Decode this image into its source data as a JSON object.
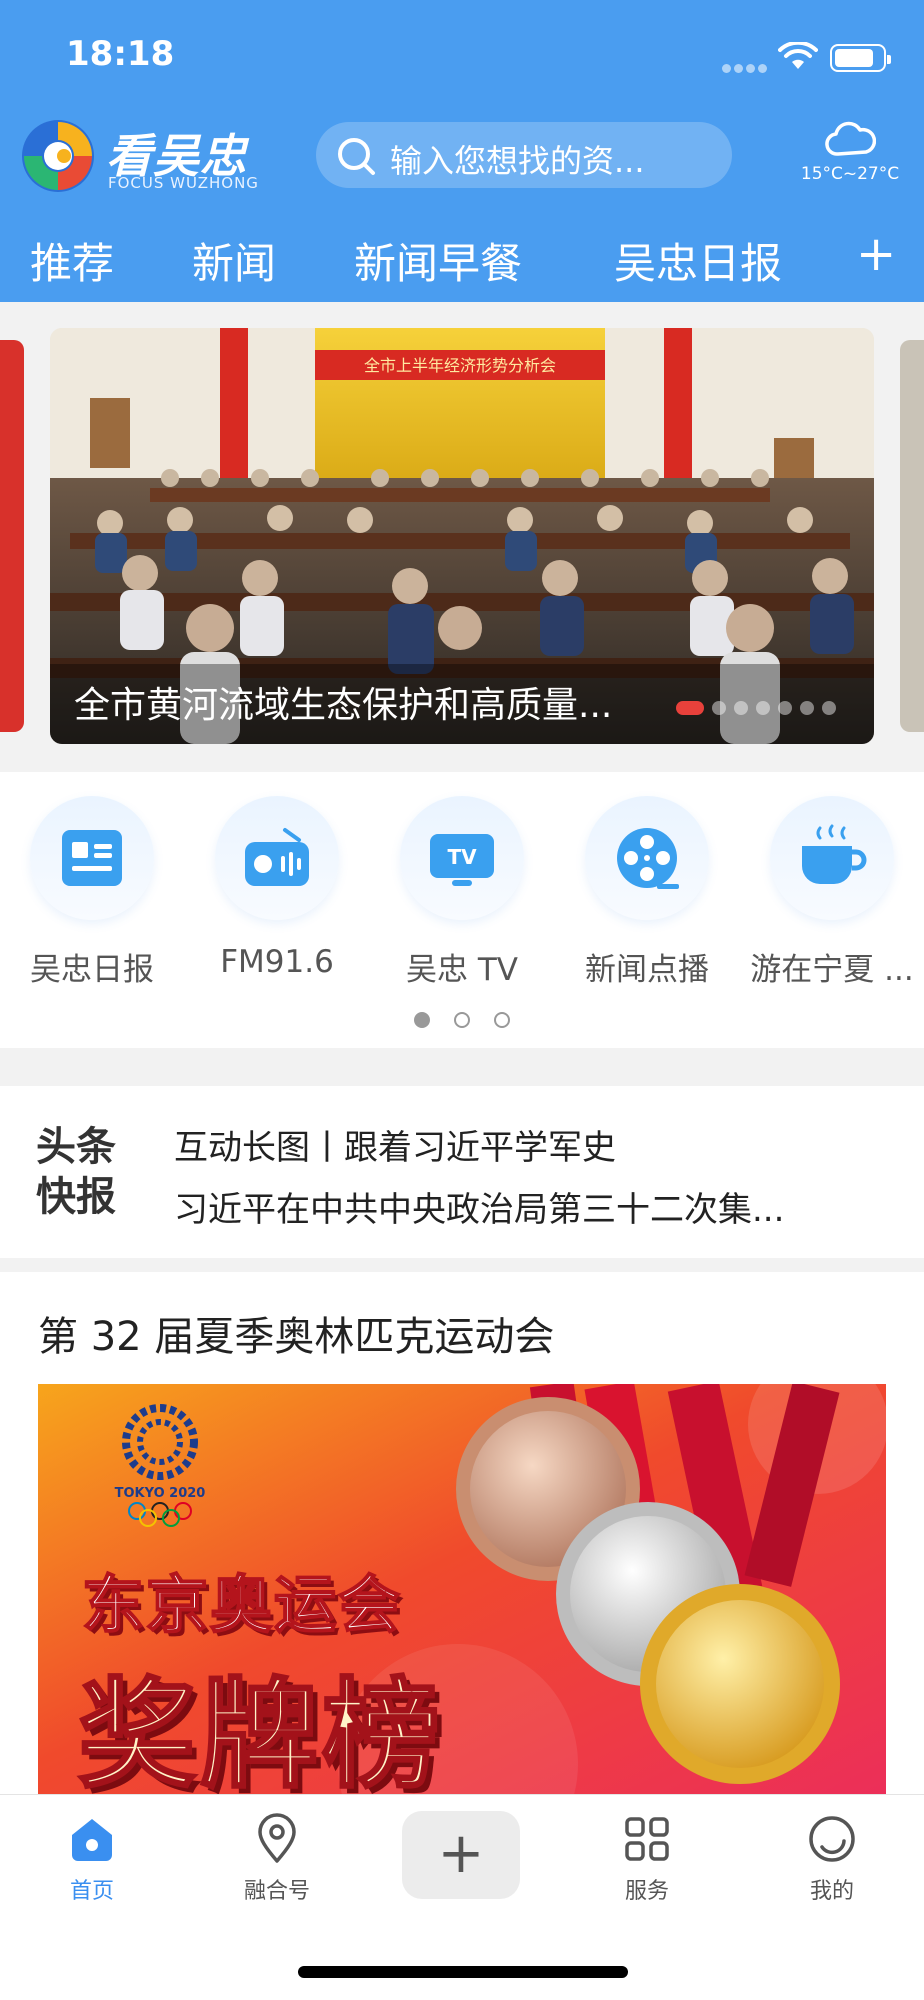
{
  "status_bar": {
    "time": "18:18"
  },
  "header": {
    "logo_cn": "看吴忠",
    "logo_en": "FOCUS WUZHONG",
    "search_placeholder": "输入您想找的资...",
    "weather_temp": "15°C~27°C",
    "weather_icon": "cloud-icon"
  },
  "tabs": [
    {
      "label": "推荐"
    },
    {
      "label": "新闻"
    },
    {
      "label": "新闻早餐"
    },
    {
      "label": "吴忠日报"
    }
  ],
  "tab_add_label": "+",
  "banner": {
    "caption": "全市黄河流域生态保护和高质量...",
    "photo_banner_text": "全市上半年经济形势分析会",
    "slide_count": 8,
    "active_slide": 1
  },
  "icons": [
    {
      "label": "吴忠日报",
      "icon": "newspaper-icon"
    },
    {
      "label": "FM91.6",
      "icon": "radio-icon"
    },
    {
      "label": "吴忠 TV",
      "icon": "tv-icon"
    },
    {
      "label": "新闻点播",
      "icon": "film-reel-icon"
    },
    {
      "label": "游在宁夏 ...",
      "icon": "coffee-cup-icon"
    }
  ],
  "icon_tv_text": "TV",
  "icon_pages": {
    "count": 3,
    "active": 1
  },
  "headlines": {
    "logo_line1": "头条",
    "logo_line2": "快报",
    "items": [
      "互动长图丨跟着习近平学军史",
      "习近平在中共中央政治局第三十二次集..."
    ]
  },
  "feature": {
    "title": "第 32 届夏季奥林匹克运动会",
    "image_line1": "东京奥运会",
    "image_line2": "奖牌榜",
    "image_badge": "TOKYO 2020"
  },
  "bottom_nav": {
    "items": [
      {
        "label": "首页",
        "icon": "home-icon",
        "active": true
      },
      {
        "label": "融合号",
        "icon": "location-pin-icon",
        "active": false
      },
      {
        "label": "服务",
        "icon": "grid-icon",
        "active": false
      },
      {
        "label": "我的",
        "icon": "profile-icon",
        "active": false
      }
    ],
    "plus_label": "+"
  },
  "colors": {
    "header_blue": "#4a9df0",
    "accent_red": "#e8413b",
    "active_nav": "#3a8ff0"
  }
}
